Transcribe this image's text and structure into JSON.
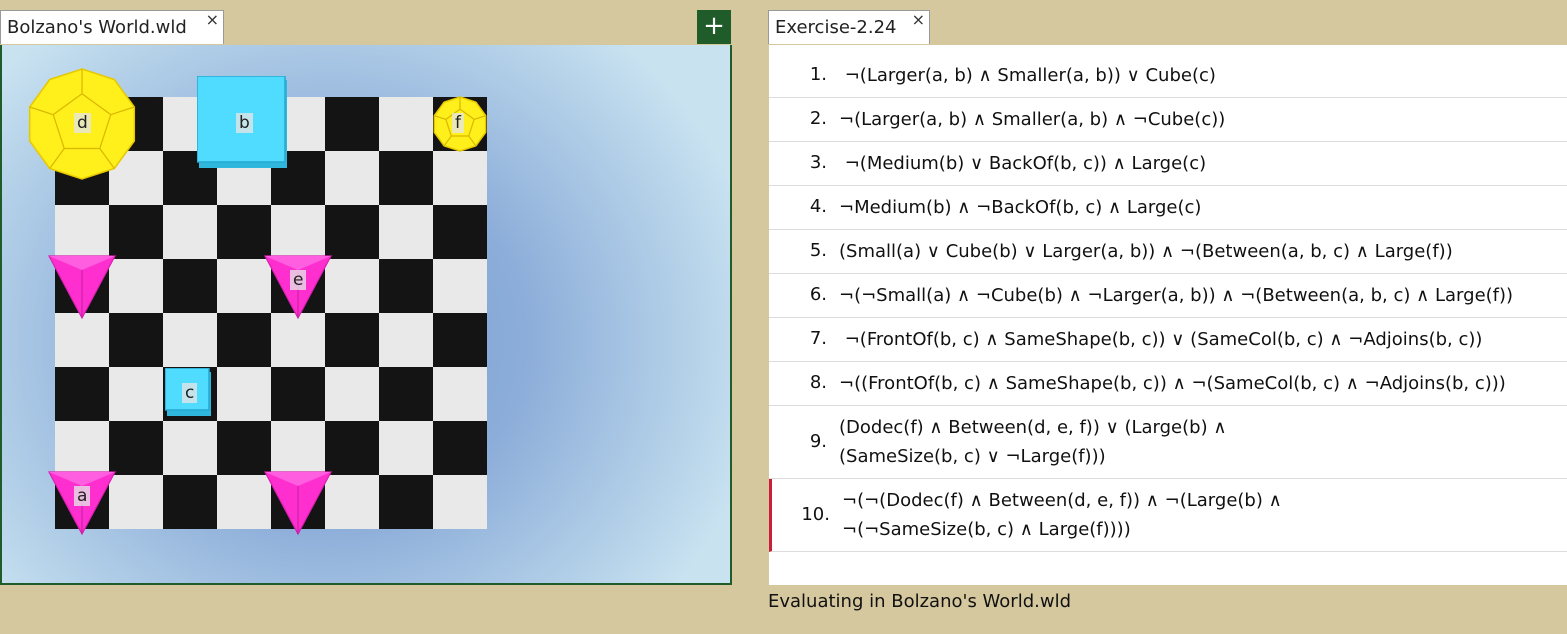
{
  "world_tab": {
    "title": "Bolzano's World.wld",
    "close": "×"
  },
  "add_button": {
    "label": "+"
  },
  "exercise_tab": {
    "title": "Exercise-2.24",
    "close": "×"
  },
  "colors": {
    "cube": "#4fdcff",
    "dodec": "#ffef1a",
    "tet": "#ff2fcf",
    "active_marker": "#c8203c"
  },
  "world": {
    "grid_size": 8,
    "objects": [
      {
        "name": "a",
        "shape": "tetrahedron",
        "size": "small",
        "col": 0,
        "row": 7
      },
      {
        "name": "b",
        "shape": "cube",
        "size": "large",
        "col": 3,
        "row": 0
      },
      {
        "name": "c",
        "shape": "cube",
        "size": "small",
        "col": 2,
        "row": 5
      },
      {
        "name": "d",
        "shape": "dodecahedron",
        "size": "large",
        "col": 0,
        "row": 0
      },
      {
        "name": "e",
        "shape": "tetrahedron",
        "size": "small",
        "col": 4,
        "row": 3
      },
      {
        "name": "f",
        "shape": "dodecahedron",
        "size": "small",
        "col": 7,
        "row": 0
      },
      {
        "name": "",
        "shape": "tetrahedron",
        "size": "small",
        "col": 0,
        "row": 3
      },
      {
        "name": "",
        "shape": "tetrahedron",
        "size": "small",
        "col": 4,
        "row": 7
      }
    ]
  },
  "sentences": [
    {
      "num": "1.",
      "text": " ¬(Larger(a, b) ∧ Smaller(a, b)) ∨ Cube(c)"
    },
    {
      "num": "2.",
      "text": "¬(Larger(a, b) ∧ Smaller(a, b) ∧ ¬Cube(c))"
    },
    {
      "num": "3.",
      "text": " ¬(Medium(b) ∨ BackOf(b, c)) ∧ Large(c)"
    },
    {
      "num": "4.",
      "text": "¬Medium(b) ∧ ¬BackOf(b, c) ∧ Large(c)"
    },
    {
      "num": "5.",
      "text": "(Small(a) ∨ Cube(b) ∨ Larger(a, b)) ∧ ¬(Between(a, b, c) ∧ Large(f))"
    },
    {
      "num": "6.",
      "text": "¬(¬Small(a) ∧ ¬Cube(b) ∧ ¬Larger(a, b)) ∧ ¬(Between(a, b, c) ∧ Large(f))"
    },
    {
      "num": "7.",
      "text": " ¬(FrontOf(b, c) ∧ SameShape(b, c)) ∨ (SameCol(b, c) ∧ ¬Adjoins(b, c))"
    },
    {
      "num": "8.",
      "text": "¬((FrontOf(b, c) ∧ SameShape(b, c)) ∧ ¬(SameCol(b, c) ∧ ¬Adjoins(b, c)))"
    },
    {
      "num": "9.",
      "text": "(Dodec(f) ∧ Between(d, e, f)) ∨ (Large(b) ∧\n(SameSize(b, c) ∨ ¬Large(f)))"
    },
    {
      "num": "10.",
      "text": "¬(¬(Dodec(f) ∧ Between(d, e, f)) ∧ ¬(Large(b) ∧\n¬(¬SameSize(b, c) ∧ Large(f))))",
      "active": true
    }
  ],
  "status": "Evaluating in Bolzano's World.wld"
}
